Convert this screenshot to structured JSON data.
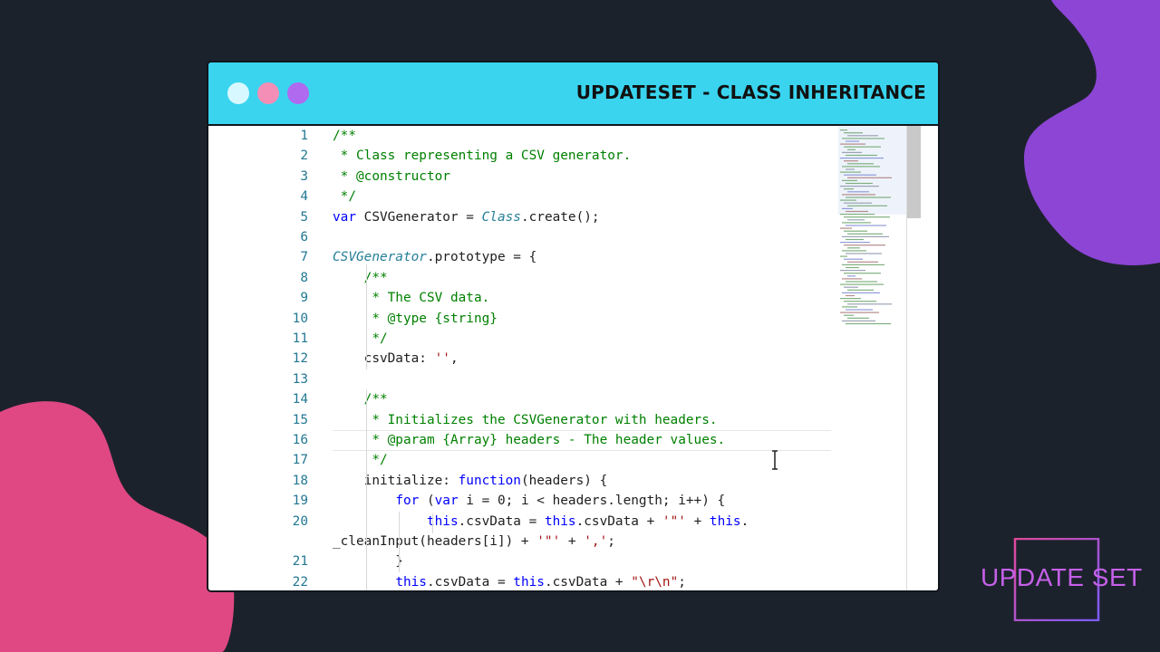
{
  "window": {
    "title": "UPDATESET - CLASS INHERITANCE",
    "traffic_dots": [
      "#d8f8ff",
      "#f58eb6",
      "#b06af0"
    ]
  },
  "editor": {
    "lines": [
      {
        "n": "1",
        "tokens": [
          [
            "cm",
            "/**"
          ]
        ]
      },
      {
        "n": "2",
        "tokens": [
          [
            "cm",
            " * Class representing a CSV generator."
          ]
        ]
      },
      {
        "n": "3",
        "tokens": [
          [
            "cm",
            " * @constructor"
          ]
        ]
      },
      {
        "n": "4",
        "tokens": [
          [
            "cm",
            " */"
          ]
        ]
      },
      {
        "n": "5",
        "tokens": [
          [
            "kw",
            "var"
          ],
          [
            "",
            " CSVGenerator = "
          ],
          [
            "cls",
            "Class"
          ],
          [
            "",
            ".create();"
          ]
        ]
      },
      {
        "n": "6",
        "tokens": []
      },
      {
        "n": "7",
        "tokens": [
          [
            "cls",
            "CSVGenerator"
          ],
          [
            "",
            ".prototype = {"
          ]
        ]
      },
      {
        "n": "8",
        "tokens": [
          [
            "",
            "    "
          ],
          [
            "cm",
            "/**"
          ]
        ]
      },
      {
        "n": "9",
        "tokens": [
          [
            "",
            "    "
          ],
          [
            "cm",
            " * The CSV data."
          ]
        ]
      },
      {
        "n": "10",
        "tokens": [
          [
            "",
            "    "
          ],
          [
            "cm",
            " * @type {string}"
          ]
        ]
      },
      {
        "n": "11",
        "tokens": [
          [
            "",
            "    "
          ],
          [
            "cm",
            " */"
          ]
        ]
      },
      {
        "n": "12",
        "tokens": [
          [
            "",
            "    csvData: "
          ],
          [
            "str",
            "''"
          ],
          [
            "",
            ","
          ]
        ]
      },
      {
        "n": "13",
        "tokens": []
      },
      {
        "n": "14",
        "tokens": [
          [
            "",
            "    "
          ],
          [
            "cm",
            "/**"
          ]
        ]
      },
      {
        "n": "15",
        "tokens": [
          [
            "",
            "    "
          ],
          [
            "cm",
            " * Initializes the CSVGenerator with headers."
          ]
        ]
      },
      {
        "n": "16",
        "tokens": [
          [
            "",
            "    "
          ],
          [
            "cm",
            " * @param {Array} headers - The header values."
          ]
        ]
      },
      {
        "n": "17",
        "tokens": [
          [
            "",
            "    "
          ],
          [
            "cm",
            " */"
          ]
        ]
      },
      {
        "n": "18",
        "tokens": [
          [
            "",
            "    initialize: "
          ],
          [
            "kw",
            "function"
          ],
          [
            "",
            "(headers) {"
          ]
        ]
      },
      {
        "n": "19",
        "tokens": [
          [
            "",
            "        "
          ],
          [
            "kw",
            "for"
          ],
          [
            "",
            " ("
          ],
          [
            "kw",
            "var"
          ],
          [
            "",
            " i = 0; i < headers.length; i++) {"
          ]
        ]
      },
      {
        "n": "20",
        "tokens": [
          [
            "",
            "            "
          ],
          [
            "kw",
            "this"
          ],
          [
            "",
            ".csvData = "
          ],
          [
            "kw",
            "this"
          ],
          [
            "",
            ".csvData + "
          ],
          [
            "str",
            "'\"'"
          ],
          [
            "",
            " + "
          ],
          [
            "kw",
            "this"
          ],
          [
            "",
            "."
          ]
        ]
      },
      {
        "n": "",
        "tokens": [
          [
            "",
            "_cleanInput(headers[i]) + "
          ],
          [
            "str",
            "'\"'"
          ],
          [
            "",
            " + "
          ],
          [
            "str",
            "','"
          ],
          [
            "",
            ";"
          ]
        ]
      },
      {
        "n": "21",
        "tokens": [
          [
            "",
            "        }"
          ]
        ]
      },
      {
        "n": "22",
        "tokens": [
          [
            "",
            "        "
          ],
          [
            "kw",
            "this"
          ],
          [
            "",
            ".csvData = "
          ],
          [
            "kw",
            "this"
          ],
          [
            "",
            ".csvData + "
          ],
          [
            "str",
            "\"\\r\\n\""
          ],
          [
            "",
            ";"
          ]
        ]
      }
    ]
  },
  "logo": {
    "text": "UPDATE SET"
  },
  "colors": {
    "background": "#1c222c",
    "titlebar": "#3ad4ef",
    "blob_purple": "#8c45d4",
    "blob_pink": "#e04883"
  }
}
